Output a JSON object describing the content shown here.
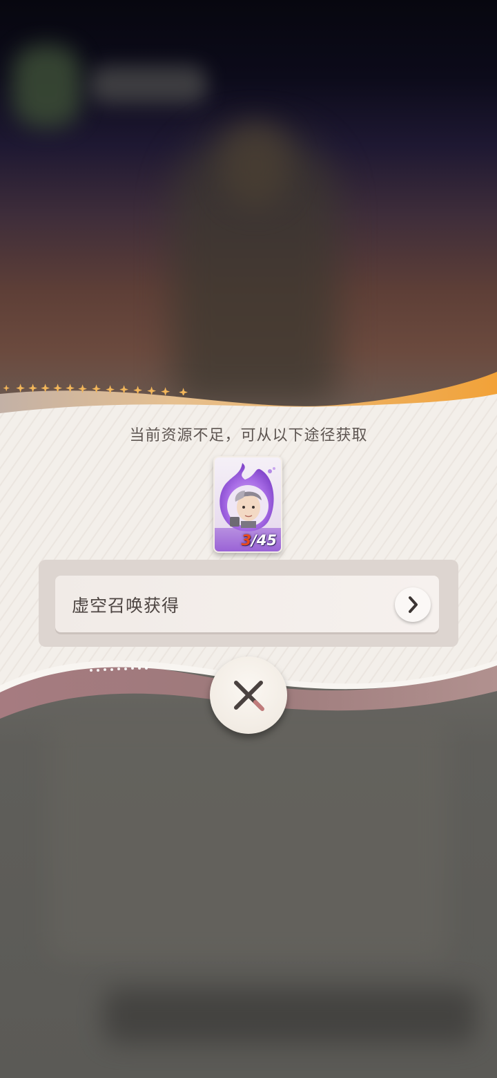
{
  "dialog": {
    "title": "当前资源不足，可从以下途径获取",
    "item": {
      "current": "3",
      "separator": "/",
      "required": "45"
    },
    "sources": [
      {
        "label": "虚空召唤获得"
      }
    ]
  },
  "icons": {
    "arrow": "chevron-right-icon",
    "close": "close-icon"
  },
  "colors": {
    "accent_orange": "#f0a43c",
    "card_purple": "#9b5fd6",
    "count_red": "#e84a1c"
  }
}
